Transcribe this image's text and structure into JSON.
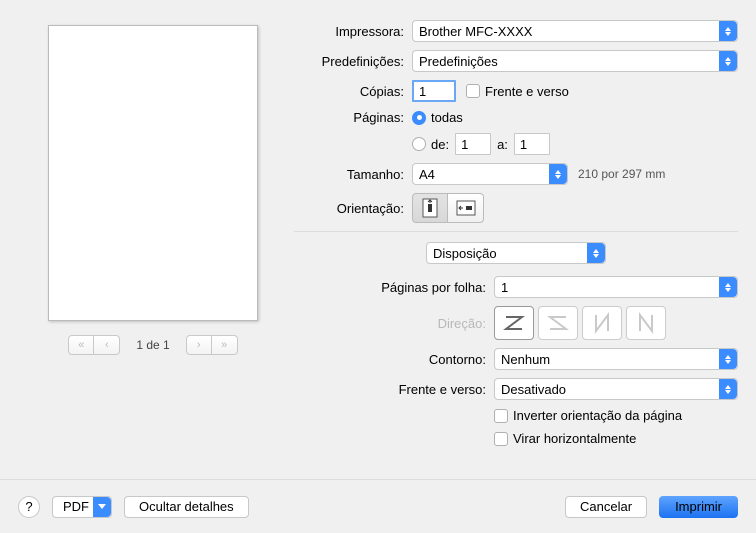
{
  "printer": {
    "label": "Impressora:",
    "value": "Brother MFC-XXXX"
  },
  "presets": {
    "label": "Predefinições:",
    "value": "Predefinições"
  },
  "copies": {
    "label": "Cópias:",
    "value": "1"
  },
  "two_sided": "Frente e verso",
  "pages": {
    "label": "Páginas:",
    "all": "todas",
    "from_label": "de:",
    "from": "1",
    "to_label": "a:",
    "to": "1"
  },
  "size": {
    "label": "Tamanho:",
    "value": "A4",
    "dims": "210 por 297 mm"
  },
  "orientation_label": "Orientação:",
  "section": "Disposição",
  "layout": {
    "pages_per_sheet_label": "Páginas por folha:",
    "pages_per_sheet": "1",
    "direction_label": "Direção:",
    "border_label": "Contorno:",
    "border": "Nenhum",
    "duplex_label": "Frente e verso:",
    "duplex": "Desativado",
    "reverse": "Inverter orientação da página",
    "flip": "Virar horizontalmente"
  },
  "preview_pager": "1 de 1",
  "footer": {
    "pdf": "PDF",
    "hide_details": "Ocultar detalhes",
    "cancel": "Cancelar",
    "print": "Imprimir"
  }
}
